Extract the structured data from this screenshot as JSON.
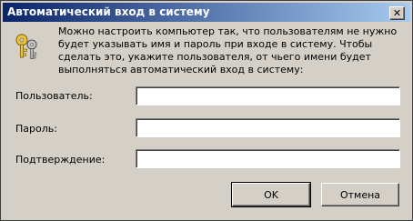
{
  "window": {
    "title": "Автоматический вход в систему",
    "close_label": "✕"
  },
  "description": "Можно настроить компьютер так, что пользователям не нужно будет указывать имя и пароль при входе в систему. Чтобы сделать это, укажите пользователя, от чьего имени будет выполняться автоматический вход в систему:",
  "form": {
    "user_label": "Пользователь:",
    "user_value": "",
    "password_label": "Пароль:",
    "password_value": "",
    "confirm_label": "Подтверждение:",
    "confirm_value": ""
  },
  "buttons": {
    "ok_label": "OK",
    "cancel_label": "Отмена"
  },
  "icons": {
    "dialog_icon": "keys-icon"
  }
}
